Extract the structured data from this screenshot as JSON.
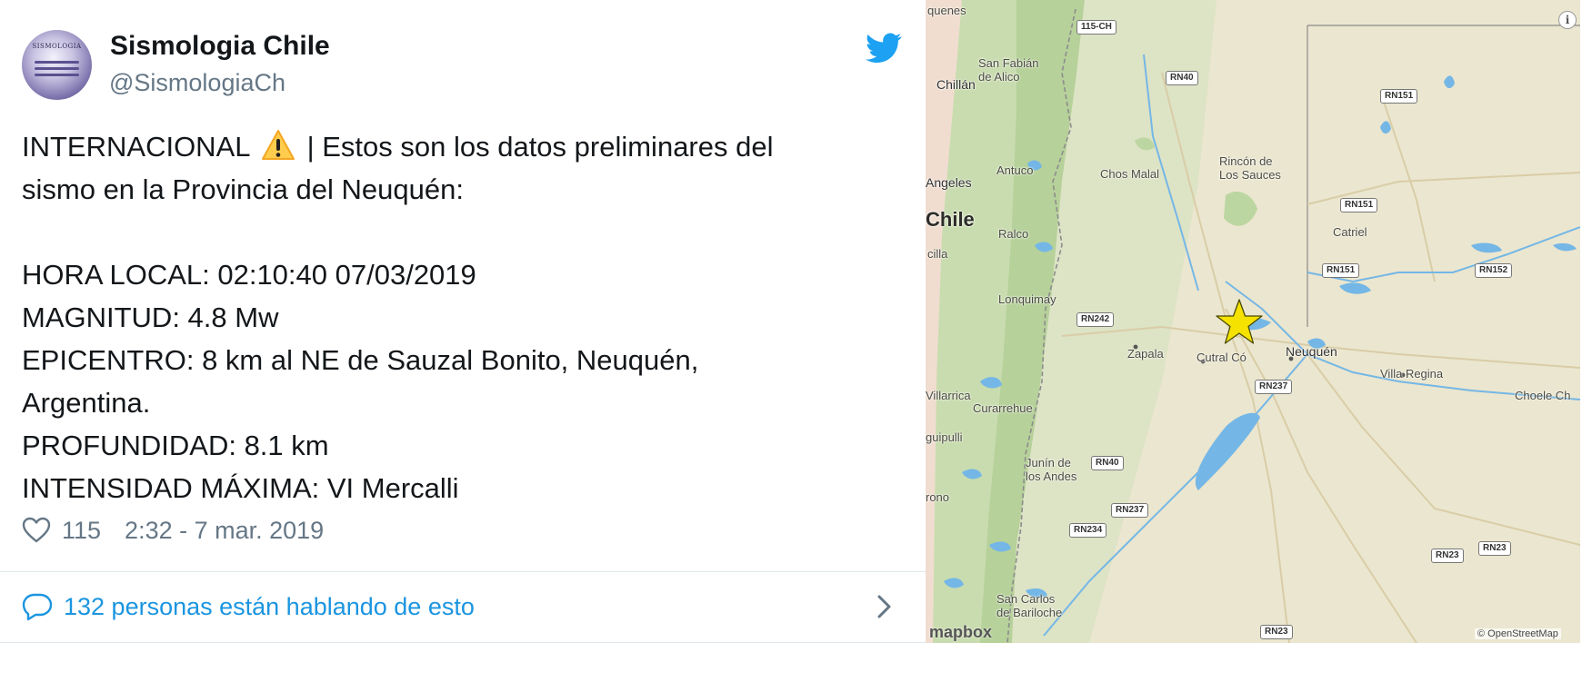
{
  "tweet": {
    "display_name": "Sismologia Chile",
    "handle": "@SismologiaCh",
    "avatar_text": "SISMOLOGIA",
    "line1_before": "INTERNACIONAL ",
    "line1_after": " | Estos son los datos preliminares del",
    "line2": "sismo en la Provincia del Neuquén:",
    "line3": "HORA LOCAL: 02:10:40 07/03/2019",
    "line4": "MAGNITUD: 4.8 Mw",
    "line5": "EPICENTRO: 8 km al NE de Sauzal Bonito, Neuquén,",
    "line6": "Argentina.",
    "line7": "PROFUNDIDAD: 8.1 km",
    "line8": "INTENSIDAD MÁXIMA: VI Mercalli",
    "likes": "115",
    "timestamp": "2:32 - 7 mar. 2019",
    "talking": "132 personas están hablando de esto",
    "icons": [
      "twitter-bird-icon",
      "warning-icon",
      "heart-icon",
      "speech-bubble-icon",
      "chevron-right-icon"
    ],
    "colors": {
      "link": "#1b95e0",
      "secondary": "#657786",
      "twitter_blue": "#1da1f2"
    }
  },
  "map": {
    "labels": {
      "quenes": "quenes",
      "san_fabian": "San Fabián\nde Alico",
      "chillan": "Chillán",
      "angeles": "Angeles",
      "antuco": "Antuco",
      "chile": "Chile",
      "ralco": "Ralco",
      "cilla": "cilla",
      "lonquimay": "Lonquimay",
      "chos_malal": "Chos Malal",
      "rincon": "Rincón de\nLos Sauces",
      "catriel": "Catriel",
      "zapala": "Zapala",
      "cutral_co": "Cutral Có",
      "neuquen": "Neuquén",
      "villa_regina": "Villa Regina",
      "choele": "Choele Ch",
      "villarrica": "Villarrica",
      "curarrehue": "Curarrehue",
      "guipulli": "guipulli",
      "junin": "Junín de\nlos Andes",
      "rono": "rono",
      "san_carlos": "San Carlos\nde Bariloche"
    },
    "roads": {
      "r115": "115-CH",
      "rn40a": "RN40",
      "rn151a": "RN151",
      "rn151b": "RN151",
      "rn151c": "RN151",
      "rn152": "RN152",
      "rn242": "RN242",
      "rn237a": "RN237",
      "rn40b": "RN40",
      "rn237b": "RN237",
      "rn234": "RN234",
      "rn23a": "RN23",
      "rn23b": "RN23",
      "rn23c": "RN23"
    },
    "info": "i",
    "logo": "mapbox",
    "attribution": "© OpenStreetMap",
    "epicenter_marker": "star",
    "colors": {
      "land": "#ebe6cf",
      "water": "#74b7e6",
      "forest": "#bcd6a1",
      "star": "#f5e200"
    }
  }
}
